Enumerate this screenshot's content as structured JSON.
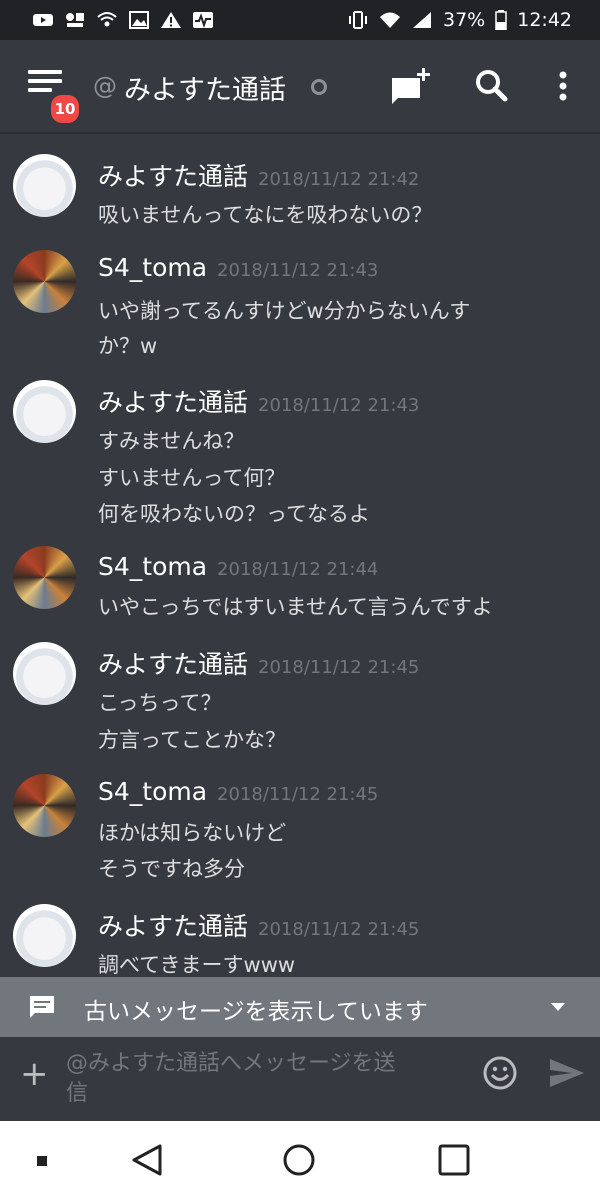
{
  "status_bar": {
    "battery": "37%",
    "time": "12:42"
  },
  "header": {
    "badge_count": "10",
    "at_symbol": "@",
    "channel_title": "みよすた通話"
  },
  "messages": [
    {
      "author": "みよすた通話",
      "timestamp": "2018/11/12 21:42",
      "lines": [
        "吸いませんってなにを吸わないの？"
      ]
    },
    {
      "author": "S4_toma",
      "timestamp": "2018/11/12 21:43",
      "lines": [
        "いや謝ってるんすけどw分からないんす",
        "か？w"
      ]
    },
    {
      "author": "みよすた通話",
      "timestamp": "2018/11/12 21:43",
      "lines": [
        "すみませんね？",
        "すいませんって何？",
        "何を吸わないの？ってなるよ"
      ]
    },
    {
      "author": "S4_toma",
      "timestamp": "2018/11/12 21:44",
      "lines": [
        "いやこっちではすいませんて言うんですよ"
      ]
    },
    {
      "author": "みよすた通話",
      "timestamp": "2018/11/12 21:45",
      "lines": [
        "こっちって？",
        "方言ってことかな？"
      ]
    },
    {
      "author": "S4_toma",
      "timestamp": "2018/11/12 21:45",
      "lines": [
        "ほかは知らないけど",
        "そうですね多分"
      ]
    },
    {
      "author": "みよすた通話",
      "timestamp": "2018/11/12 21:45",
      "lines": [
        "調べてきまーすwww"
      ]
    }
  ],
  "old_messages_bar": {
    "text": "古いメッセージを表示しています"
  },
  "input": {
    "placeholder_line1": "@みよすた通話へメッセージを送",
    "placeholder_line2": "信"
  }
}
